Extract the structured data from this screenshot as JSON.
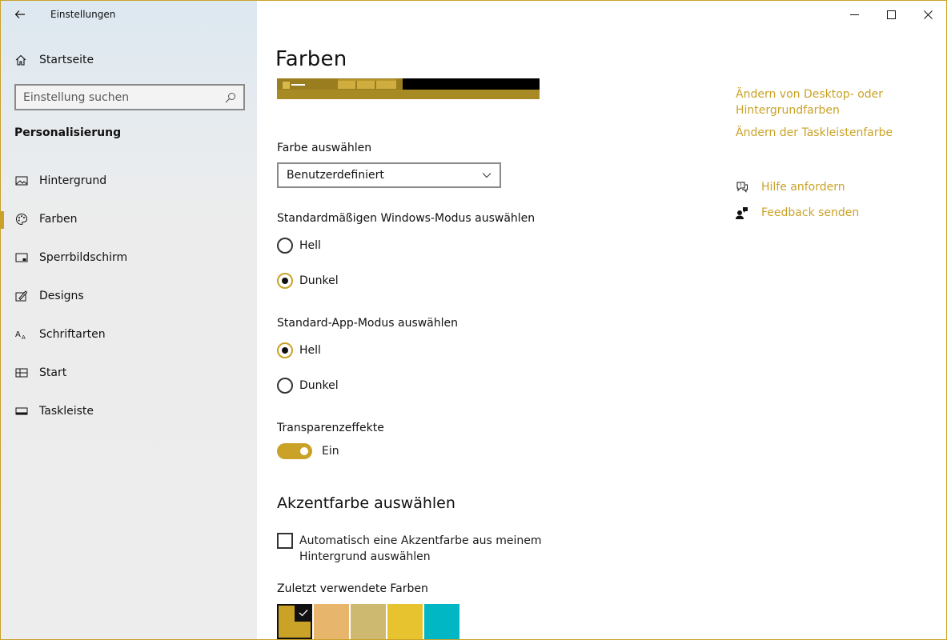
{
  "window": {
    "app_title": "Einstellungen",
    "accent_color": "#c9a227"
  },
  "sidebar": {
    "home_label": "Startseite",
    "search_placeholder": "Einstellung suchen",
    "section_title": "Personalisierung",
    "items": [
      {
        "label": "Hintergrund",
        "icon": "picture-icon"
      },
      {
        "label": "Farben",
        "icon": "palette-icon",
        "selected": true
      },
      {
        "label": "Sperrbildschirm",
        "icon": "lockscreen-icon"
      },
      {
        "label": "Designs",
        "icon": "themes-icon"
      },
      {
        "label": "Schriftarten",
        "icon": "fonts-icon"
      },
      {
        "label": "Start",
        "icon": "start-icon"
      },
      {
        "label": "Taskleiste",
        "icon": "taskbar-icon"
      }
    ]
  },
  "main": {
    "title": "Farben",
    "color_select_label": "Farbe auswählen",
    "color_select_value": "Benutzerdefiniert",
    "windows_mode_label": "Standardmäßigen Windows-Modus auswählen",
    "windows_mode_options": [
      "Hell",
      "Dunkel"
    ],
    "windows_mode_selected": "Dunkel",
    "app_mode_label": "Standard-App-Modus auswählen",
    "app_mode_options": [
      "Hell",
      "Dunkel"
    ],
    "app_mode_selected": "Hell",
    "transparency_label": "Transparenzeffekte",
    "transparency_state": "Ein",
    "accent_heading": "Akzentfarbe auswählen",
    "auto_accent_label": "Automatisch eine Akzentfarbe aus meinem Hintergrund auswählen",
    "recent_colors_label": "Zuletzt verwendete Farben",
    "recent_colors": [
      "#c9a227",
      "#e8b56c",
      "#cdb96f",
      "#e7c330",
      "#00b7c3"
    ]
  },
  "related": {
    "link1": "Ändern von Desktop- oder Hintergrundfarben",
    "link2": "Ändern der Taskleistenfarbe",
    "help": "Hilfe anfordern",
    "feedback": "Feedback senden"
  }
}
